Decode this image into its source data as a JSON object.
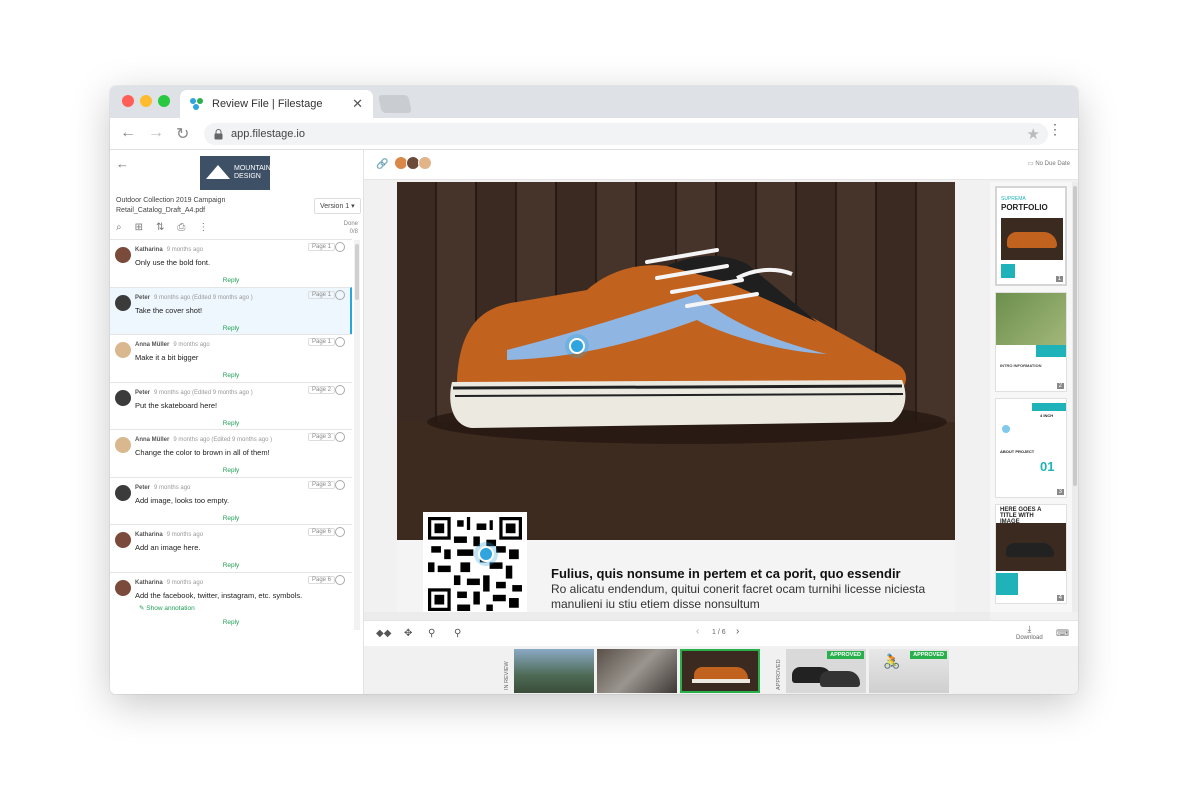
{
  "browser": {
    "tab_title": "Review File | Filestage",
    "tab_close": "✕",
    "url": "app.filestage.io",
    "back": "←",
    "forward": "→",
    "reload": "↻",
    "star": "★",
    "menu": "⋮"
  },
  "sidebar": {
    "back": "←",
    "logo_line1": "MOUNTAIN",
    "logo_line2": "DESIGN",
    "project": "Outdoor Collection 2019 Campaign",
    "file": "Retail_Catalog_Draft_A4.pdf",
    "version": "Version 1 ▾",
    "done_label": "Done",
    "done_count": "0/8",
    "tools": [
      "⌕",
      "⊞",
      "⇅",
      "⎙",
      "⋮"
    ],
    "reply_label": "Reply",
    "comments": [
      {
        "author": "Katharina",
        "meta": "9 months ago",
        "text": "Only use the bold font.",
        "page": "Page 1",
        "avatar_color": "#7a4a3a"
      },
      {
        "author": "Peter",
        "meta": "9 months ago (Edited 9 months ago )",
        "text": "Take the cover shot!",
        "page": "Page 1",
        "avatar_color": "#3b3b3b"
      },
      {
        "author": "Anna Müller",
        "meta": "9 months ago",
        "text": "Make it a bit bigger",
        "page": "Page 1",
        "avatar_color": "#d9b88f"
      },
      {
        "author": "Peter",
        "meta": "9 months ago (Edited 9 months ago )",
        "text": "Put the skateboard here!",
        "page": "Page 2",
        "avatar_color": "#3b3b3b"
      },
      {
        "author": "Anna Müller",
        "meta": "9 months ago (Edited 9 months ago )",
        "text": "Change the color to brown in all of them!",
        "page": "Page 3",
        "avatar_color": "#d9b88f"
      },
      {
        "author": "Peter",
        "meta": "9 months ago",
        "text": "Add image, looks too empty.",
        "page": "Page 3",
        "avatar_color": "#3b3b3b"
      },
      {
        "author": "Katharina",
        "meta": "9 months ago",
        "text": "Add an image here.",
        "page": "Page 6",
        "avatar_color": "#7a4a3a"
      },
      {
        "author": "Katharina",
        "meta": "9 months ago",
        "text": "Add the facebook, twitter, instagram, etc. symbols.",
        "page": "Page 6",
        "avatar_color": "#7a4a3a"
      }
    ],
    "show_annotation": "Show annotation"
  },
  "viewer": {
    "due_date": "No Due Date",
    "page_heading": "Fulius, quis nonsume in pertem et ca porit, quo essendir",
    "page_body": "Ro alicatu endendum, quitui conerit facret ocam turnihi licesse niciesta manulieni iu stiu etiem disse nonsultum",
    "pagination": "1 / 6",
    "prev": "‹",
    "next": "›",
    "download": "Download",
    "thumbnails": [
      {
        "number": "1",
        "title": "PORTFOLIO",
        "brand": "SUPREMA"
      },
      {
        "number": "2",
        "title": "INTRO INFORMATION"
      },
      {
        "number": "3",
        "title": "ABOUT PROJECT",
        "big": "01",
        "side": "4 INCH"
      },
      {
        "number": "4",
        "title": "HERE GOES A TITLE WITH IMAGE"
      }
    ]
  },
  "filmstrip": {
    "in_review_label": "IN REVIEW",
    "approved_label": "APPROVED",
    "badge": "APPROVED"
  },
  "colors": {
    "accent_green": "#27b04b",
    "accent_blue": "#2fa4de",
    "teal": "#1fb3b9"
  }
}
